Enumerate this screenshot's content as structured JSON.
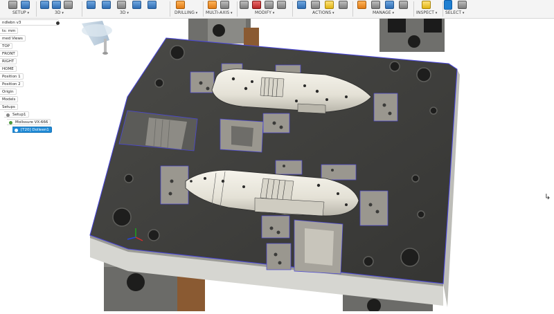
{
  "toolbar": {
    "groups": [
      {
        "label": "SETUP"
      },
      {
        "label": "3D"
      },
      {
        "label": "3D"
      },
      {
        "label": "DRILLING"
      },
      {
        "label": "MULTI-AXIS"
      },
      {
        "label": "MODIFY"
      },
      {
        "label": "ACTIONS"
      },
      {
        "label": "MANAGE"
      },
      {
        "label": "INSPECT"
      },
      {
        "label": "SELECT"
      }
    ]
  },
  "browser": {
    "items": [
      {
        "label": "ndlebn v3"
      },
      {
        "label": "ts: mm"
      },
      {
        "label": "med Views"
      },
      {
        "label": "TOP"
      },
      {
        "label": "FRONT"
      },
      {
        "label": "RIGHT"
      },
      {
        "label": "HOME"
      },
      {
        "label": "Position 1"
      },
      {
        "label": "Position 2"
      },
      {
        "label": "Origin"
      },
      {
        "label": "Models"
      },
      {
        "label": "Setups"
      },
      {
        "label": "Setup1"
      },
      {
        "label": "Mollssure VX-666"
      },
      {
        "label": "[T20] Dolleen1"
      }
    ]
  },
  "colors": {
    "plate_top": "#3f3f3d",
    "plate_side": "#cfcfca",
    "part": "#ece9df",
    "selection_edge": "#4a47d6",
    "accent": "#1f8ad6"
  },
  "icons": [
    "setup-icon",
    "box-icon",
    "surface-icon",
    "drill-icon",
    "multiaxis-icon",
    "scissors-icon",
    "actions-icon",
    "manage-icon",
    "inspect-icon",
    "select-icon",
    "triad-icon"
  ]
}
